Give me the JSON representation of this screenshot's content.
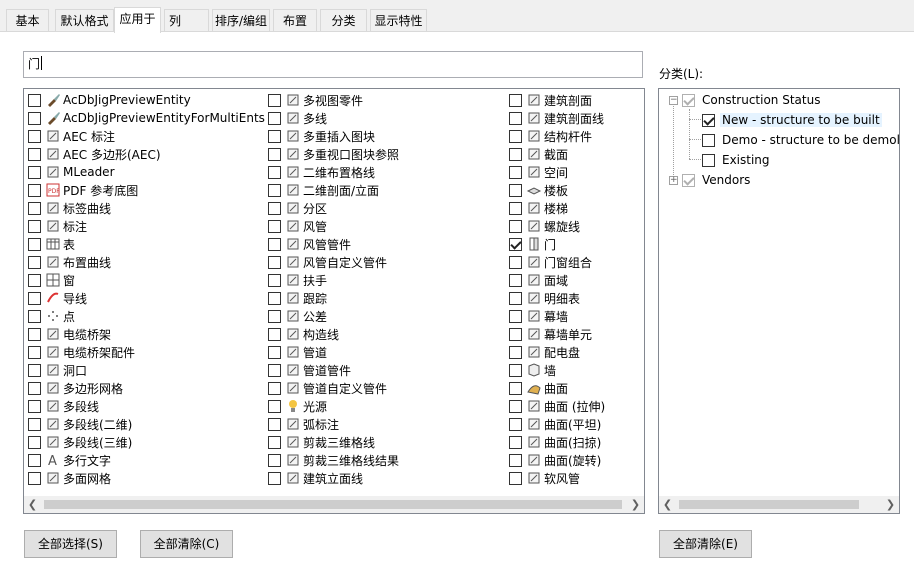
{
  "tabs": [
    {
      "label": "基本"
    },
    {
      "label": "默认格式"
    },
    {
      "label": "应用于"
    },
    {
      "label": "列"
    },
    {
      "label": "排序/编组"
    },
    {
      "label": "布置"
    },
    {
      "label": "分类"
    },
    {
      "label": "显示特性"
    }
  ],
  "active_tab": "应用于",
  "search": {
    "value": "门"
  },
  "objects": {
    "col1": [
      {
        "label": "AcDbJigPreviewEntity",
        "checked": false,
        "icon": "brush-icon"
      },
      {
        "label": "AcDbJigPreviewEntityForMultiEnts",
        "checked": false,
        "icon": "brush-icon"
      },
      {
        "label": "AEC 标注",
        "checked": false,
        "icon": "dimension-icon"
      },
      {
        "label": "AEC 多边形(AEC)",
        "checked": false,
        "icon": "polygon-icon"
      },
      {
        "label": "MLeader",
        "checked": false,
        "icon": "mleader-icon"
      },
      {
        "label": "PDF 参考底图",
        "checked": false,
        "icon": "pdf-icon"
      },
      {
        "label": "标签曲线",
        "checked": false,
        "icon": "tag-curve-icon"
      },
      {
        "label": "标注",
        "checked": false,
        "icon": "annotation-icon"
      },
      {
        "label": "表",
        "checked": false,
        "icon": "table-icon"
      },
      {
        "label": "布置曲线",
        "checked": false,
        "icon": "layout-curve-icon"
      },
      {
        "label": "窗",
        "checked": false,
        "icon": "window-icon"
      },
      {
        "label": "导线",
        "checked": false,
        "icon": "leader-icon"
      },
      {
        "label": "点",
        "checked": false,
        "icon": "point-icon"
      },
      {
        "label": "电缆桥架",
        "checked": false,
        "icon": "cable-tray-icon"
      },
      {
        "label": "电缆桥架配件",
        "checked": false,
        "icon": "cable-fitting-icon"
      },
      {
        "label": "洞口",
        "checked": false,
        "icon": "opening-icon"
      },
      {
        "label": "多边形网格",
        "checked": false,
        "icon": "polygon-mesh-icon"
      },
      {
        "label": "多段线",
        "checked": false,
        "icon": "polyline-icon"
      },
      {
        "label": "多段线(二维)",
        "checked": false,
        "icon": "polyline-2d-icon"
      },
      {
        "label": "多段线(三维)",
        "checked": false,
        "icon": "polyline-3d-icon"
      },
      {
        "label": "多行文字",
        "checked": false,
        "icon": "mtext-icon"
      },
      {
        "label": "多面网格",
        "checked": false,
        "icon": "polyface-mesh-icon"
      }
    ],
    "col2": [
      {
        "label": "多视图零件",
        "checked": false,
        "icon": "multiview-part-icon"
      },
      {
        "label": "多线",
        "checked": false,
        "icon": "mline-icon"
      },
      {
        "label": "多重插入图块",
        "checked": false,
        "icon": "minsert-icon"
      },
      {
        "label": "多重视口图块参照",
        "checked": false,
        "icon": "mvblock-icon"
      },
      {
        "label": "二维布置格线",
        "checked": false,
        "icon": "grid-2d-icon"
      },
      {
        "label": "二维剖面/立面",
        "checked": false,
        "icon": "section-2d-icon"
      },
      {
        "label": "分区",
        "checked": false,
        "icon": "zone-icon"
      },
      {
        "label": "风管",
        "checked": false,
        "icon": "duct-icon"
      },
      {
        "label": "风管管件",
        "checked": false,
        "icon": "duct-fitting-icon"
      },
      {
        "label": "风管自定义管件",
        "checked": false,
        "icon": "duct-custom-icon"
      },
      {
        "label": "扶手",
        "checked": false,
        "icon": "railing-icon"
      },
      {
        "label": "跟踪",
        "checked": false,
        "icon": "trace-icon"
      },
      {
        "label": "公差",
        "checked": false,
        "icon": "tolerance-icon"
      },
      {
        "label": "构造线",
        "checked": false,
        "icon": "xline-icon"
      },
      {
        "label": "管道",
        "checked": false,
        "icon": "pipe-icon"
      },
      {
        "label": "管道管件",
        "checked": false,
        "icon": "pipe-fitting-icon"
      },
      {
        "label": "管道自定义管件",
        "checked": false,
        "icon": "pipe-custom-icon"
      },
      {
        "label": "光源",
        "checked": false,
        "icon": "light-icon"
      },
      {
        "label": "弧标注",
        "checked": false,
        "icon": "arc-dim-icon"
      },
      {
        "label": "剪裁三维格线",
        "checked": false,
        "icon": "clip-grid-icon"
      },
      {
        "label": "剪裁三维格线结果",
        "checked": false,
        "icon": "clip-grid-result-icon"
      },
      {
        "label": "建筑立面线",
        "checked": false,
        "icon": "elevation-line-icon"
      }
    ],
    "col3": [
      {
        "label": "建筑剖面",
        "checked": false,
        "icon": "building-section-icon"
      },
      {
        "label": "建筑剖面线",
        "checked": false,
        "icon": "section-line-icon"
      },
      {
        "label": "结构杆件",
        "checked": false,
        "icon": "structural-member-icon"
      },
      {
        "label": "截面",
        "checked": false,
        "icon": "profile-icon"
      },
      {
        "label": "空间",
        "checked": false,
        "icon": "space-icon"
      },
      {
        "label": "楼板",
        "checked": false,
        "icon": "slab-icon"
      },
      {
        "label": "楼梯",
        "checked": false,
        "icon": "stair-icon"
      },
      {
        "label": "螺旋线",
        "checked": false,
        "icon": "helix-icon"
      },
      {
        "label": "门",
        "checked": true,
        "icon": "door-icon"
      },
      {
        "label": "门窗组合",
        "checked": false,
        "icon": "door-window-assembly-icon"
      },
      {
        "label": "面域",
        "checked": false,
        "icon": "region-icon"
      },
      {
        "label": "明细表",
        "checked": false,
        "icon": "schedule-icon"
      },
      {
        "label": "幕墙",
        "checked": false,
        "icon": "curtain-wall-icon"
      },
      {
        "label": "幕墙单元",
        "checked": false,
        "icon": "curtain-wall-unit-icon"
      },
      {
        "label": "配电盘",
        "checked": false,
        "icon": "panel-icon"
      },
      {
        "label": "墙",
        "checked": false,
        "icon": "wall-icon"
      },
      {
        "label": "曲面",
        "checked": false,
        "icon": "surface-icon"
      },
      {
        "label": "曲面 (拉伸)",
        "checked": false,
        "icon": "surface-extrude-icon"
      },
      {
        "label": "曲面(平坦)",
        "checked": false,
        "icon": "surface-planar-icon"
      },
      {
        "label": "曲面(扫掠)",
        "checked": false,
        "icon": "surface-sweep-icon"
      },
      {
        "label": "曲面(旋转)",
        "checked": false,
        "icon": "surface-revolve-icon"
      },
      {
        "label": "软风管",
        "checked": false,
        "icon": "flex-duct-icon"
      }
    ]
  },
  "classification": {
    "label": "分类(L):",
    "tree": {
      "root1": {
        "label": "Construction Status"
      },
      "children": [
        {
          "label": "New - structure to be built",
          "checked": true
        },
        {
          "label": "Demo - structure to be demol",
          "checked": false
        },
        {
          "label": "Existing",
          "checked": false
        }
      ],
      "root2": {
        "label": "Vendors"
      }
    }
  },
  "buttons": {
    "select_all": "全部选择(S)",
    "clear_all": "全部清除(C)",
    "clear_all_class": "全部清除(E)"
  }
}
